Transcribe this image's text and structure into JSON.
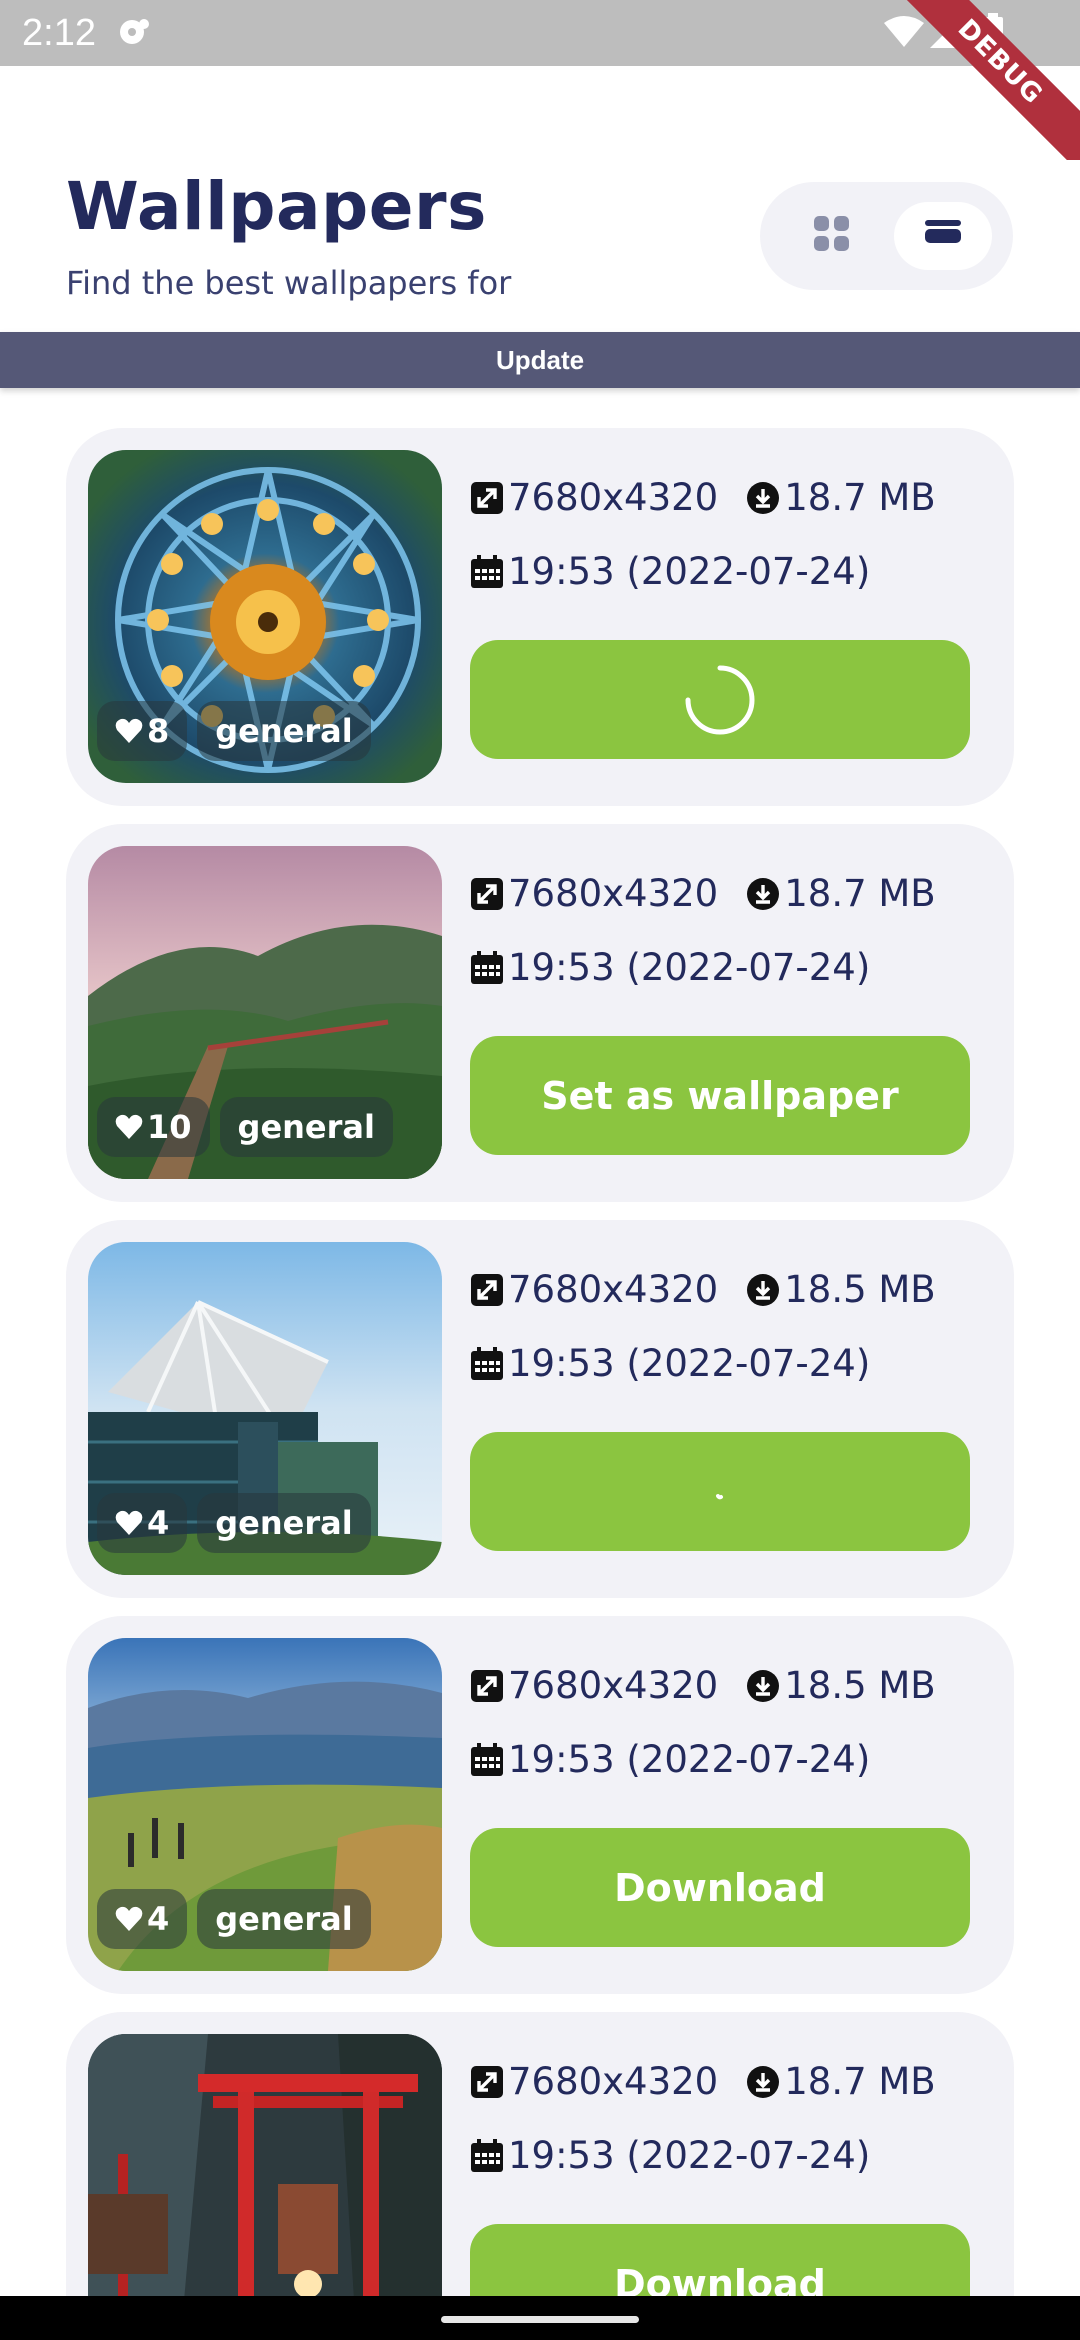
{
  "status_bar": {
    "time": "2:12",
    "debug_label": "DEBUG"
  },
  "header": {
    "title": "Wallpapers",
    "subtitle": "Find the best wallpapers for",
    "view_toggle": {
      "grid_icon": "grid-icon",
      "list_icon": "list-icon",
      "selected": "list"
    }
  },
  "update_bar": {
    "label": "Update"
  },
  "colors": {
    "title": "#232a5c",
    "accent_green": "#8bc540",
    "card_bg": "#f2f2f7",
    "update_bar": "#555877"
  },
  "wallpapers": [
    {
      "resolution": "7680x4320",
      "size": "18.7 MB",
      "date": "19:53 (2022-07-24)",
      "likes": "8",
      "category": "general",
      "button_label": "",
      "button_state": "loading-spinner"
    },
    {
      "resolution": "7680x4320",
      "size": "18.7 MB",
      "date": "19:53 (2022-07-24)",
      "likes": "10",
      "category": "general",
      "button_label": "Set as wallpaper",
      "button_state": "ready"
    },
    {
      "resolution": "7680x4320",
      "size": "18.5 MB",
      "date": "19:53 (2022-07-24)",
      "likes": "4",
      "category": "general",
      "button_label": "",
      "button_state": "loading-spinner"
    },
    {
      "resolution": "7680x4320",
      "size": "18.5 MB",
      "date": "19:53 (2022-07-24)",
      "likes": "4",
      "category": "general",
      "button_label": "Download",
      "button_state": "idle"
    },
    {
      "resolution": "7680x4320",
      "size": "18.7 MB",
      "date": "19:53 (2022-07-24)",
      "likes": "",
      "category": "",
      "button_label": "Download",
      "button_state": "idle"
    }
  ]
}
